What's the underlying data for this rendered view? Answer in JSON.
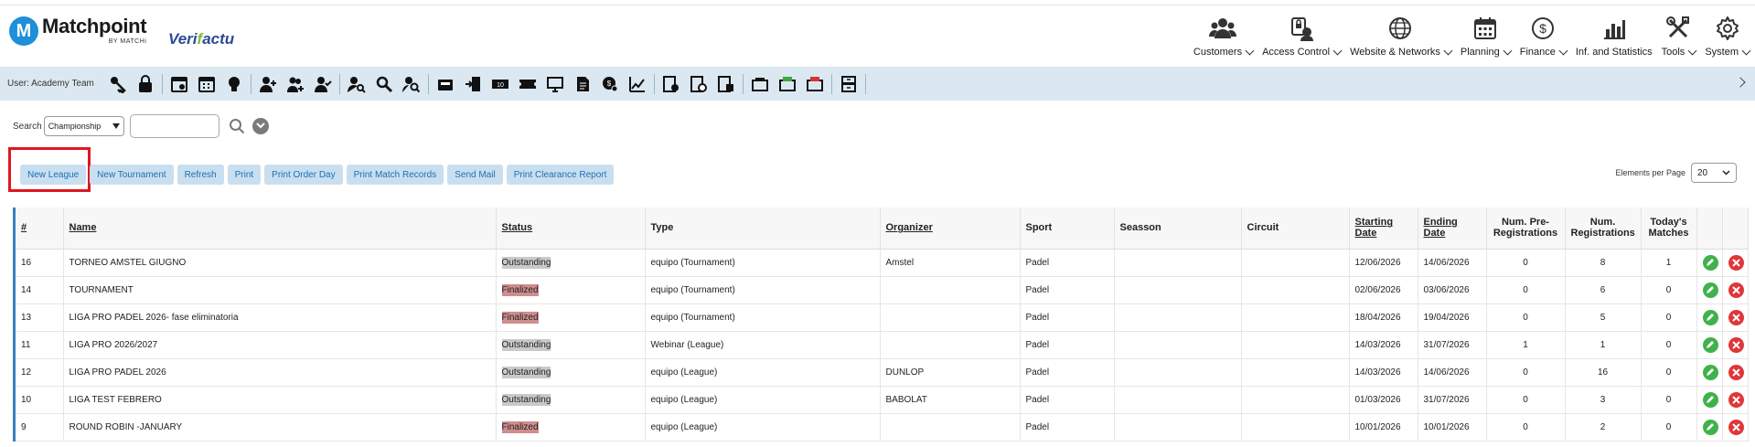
{
  "brand": {
    "logo_letter": "M",
    "name": "Matchpoint",
    "subtitle": "BY MATCHi",
    "partner_pre": "Veri",
    "partner_mid": "f",
    "partner_post": "actu"
  },
  "nav": [
    {
      "label": "Customers",
      "icon": "customers-icon"
    },
    {
      "label": "Access Control",
      "icon": "access-control-icon"
    },
    {
      "label": "Website & Networks",
      "icon": "globe-icon"
    },
    {
      "label": "Planning",
      "icon": "calendar-icon"
    },
    {
      "label": "Finance",
      "icon": "dollar-icon"
    },
    {
      "label": "Inf. and Statistics",
      "icon": "bar-chart-icon"
    },
    {
      "label": "Tools",
      "icon": "tools-icon"
    },
    {
      "label": "System",
      "icon": "gear-icon"
    }
  ],
  "toolbar": {
    "user_label": "User:  Academy Team"
  },
  "search": {
    "label": "Search",
    "selected": "Championship",
    "input_value": ""
  },
  "actions": [
    "New League",
    "New Tournament",
    "Refresh",
    "Print",
    "Print Order Day",
    "Print Match Records",
    "Send Mail",
    "Print Clearance Report"
  ],
  "elements_per_page": {
    "label": "Elements per Page",
    "value": "20"
  },
  "table": {
    "headers": [
      "#",
      "Name",
      "Status",
      "Type",
      "Organizer",
      "Sport",
      "Seasson",
      "Circuit",
      "Starting Date",
      "Ending Date",
      "Num. Pre-Registrations",
      "Num. Registrations",
      "Today's Matches"
    ],
    "rows": [
      [
        "16",
        "TORNEO AMSTEL GIUGNO",
        "Outstanding",
        "equipo (Tournament)",
        "Amstel",
        "Padel",
        "",
        "",
        "12/06/2026",
        "14/06/2026",
        "0",
        "8",
        "1"
      ],
      [
        "14",
        "TOURNAMENT",
        "Finalized",
        "equipo (Tournament)",
        "",
        "Padel",
        "",
        "",
        "02/06/2026",
        "03/06/2026",
        "0",
        "6",
        "0"
      ],
      [
        "13",
        "LIGA PRO PADEL 2026- fase eliminatoria",
        "Finalized",
        "equipo (Tournament)",
        "",
        "Padel",
        "",
        "",
        "18/04/2026",
        "19/04/2026",
        "0",
        "5",
        "0"
      ],
      [
        "11",
        "LIGA PRO 2026/2027",
        "Outstanding",
        "Webinar (League)",
        "",
        "Padel",
        "",
        "",
        "14/03/2026",
        "31/07/2026",
        "1",
        "1",
        "0"
      ],
      [
        "12",
        "LIGA PRO PADEL 2026",
        "Outstanding",
        "equipo (League)",
        "DUNLOP",
        "Padel",
        "",
        "",
        "14/03/2026",
        "14/06/2026",
        "0",
        "16",
        "0"
      ],
      [
        "10",
        "LIGA TEST FEBRERO",
        "Outstanding",
        "equipo (League)",
        "BABOLAT",
        "Padel",
        "",
        "",
        "01/03/2026",
        "31/07/2026",
        "0",
        "3",
        "0"
      ],
      [
        "9",
        "ROUND ROBIN -JANUARY",
        "Finalized",
        "equipo (League)",
        "",
        "Padel",
        "",
        "",
        "10/01/2026",
        "10/01/2026",
        "0",
        "2",
        "0"
      ]
    ]
  }
}
